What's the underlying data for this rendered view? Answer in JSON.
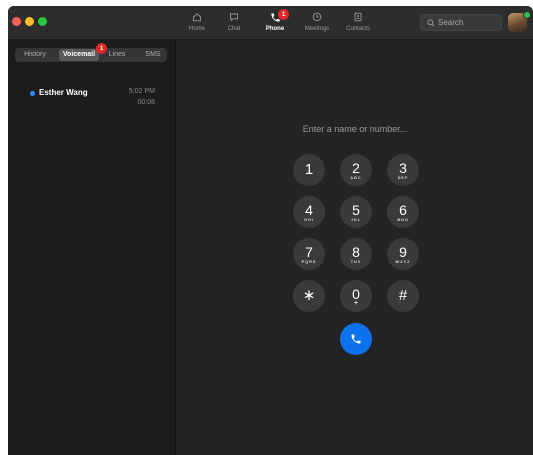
{
  "nav": {
    "items": [
      {
        "label": "Home",
        "icon": "home-icon"
      },
      {
        "label": "Chat",
        "icon": "chat-icon"
      },
      {
        "label": "Phone",
        "icon": "phone-icon",
        "badge": "1",
        "active": true
      },
      {
        "label": "Meetings",
        "icon": "clock-icon"
      },
      {
        "label": "Contacts",
        "icon": "contacts-icon"
      }
    ]
  },
  "search": {
    "placeholder": "Search"
  },
  "sidebar": {
    "tabs": [
      {
        "label": "History"
      },
      {
        "label": "Voicemail",
        "active": true,
        "badge": "1"
      },
      {
        "label": "Lines"
      },
      {
        "label": "SMS"
      }
    ],
    "voicemails": [
      {
        "name": "Esther Wang",
        "time": "5:02 PM",
        "duration": "00:08"
      }
    ]
  },
  "dialpad": {
    "placeholder": "Enter a name or number...",
    "keys": [
      {
        "digit": "1",
        "letters": ""
      },
      {
        "digit": "2",
        "letters": "ABC"
      },
      {
        "digit": "3",
        "letters": "DEF"
      },
      {
        "digit": "4",
        "letters": "GHI"
      },
      {
        "digit": "5",
        "letters": "JKL"
      },
      {
        "digit": "6",
        "letters": "MNO"
      },
      {
        "digit": "7",
        "letters": "PQRS"
      },
      {
        "digit": "8",
        "letters": "TUV"
      },
      {
        "digit": "9",
        "letters": "WXYZ"
      },
      {
        "digit": "∗",
        "letters": ""
      },
      {
        "digit": "0",
        "letters": "+"
      },
      {
        "digit": "#",
        "letters": ""
      }
    ]
  },
  "colors": {
    "accent": "#0e72ed",
    "badge": "#e02828",
    "unread_dot": "#2d8cff"
  }
}
